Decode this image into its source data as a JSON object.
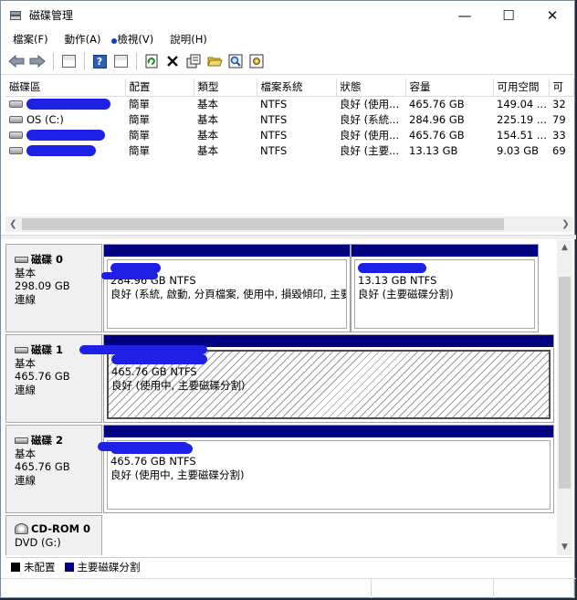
{
  "window": {
    "title": "磁碟管理",
    "buttons": [
      "—",
      "☐",
      "✕"
    ]
  },
  "menu": [
    "檔案(F)",
    "動作(A)",
    "檢視(V)",
    "說明(H)"
  ],
  "toolbar": {
    "icons": [
      "back-arrow-icon",
      "forward-arrow-icon",
      "properties-grid-icon",
      "help-icon",
      "view-grid-icon",
      "refresh-icon",
      "delete-icon",
      "properties-icon",
      "open-folder-icon",
      "explore-icon",
      "settings-icon"
    ]
  },
  "volume_table": {
    "columns": [
      "磁碟區",
      "配置",
      "類型",
      "檔案系統",
      "狀態",
      "容量",
      "可用空間",
      "可"
    ],
    "rows": [
      {
        "name": "",
        "layout": "簡單",
        "type": "基本",
        "fs": "NTFS",
        "status": "良好 (使用...",
        "capacity": "465.76 GB",
        "free": "149.04 ...",
        "pct": "32"
      },
      {
        "name": "OS (C:)",
        "layout": "簡單",
        "type": "基本",
        "fs": "NTFS",
        "status": "良好 (系統...",
        "capacity": "284.96 GB",
        "free": "225.19 ...",
        "pct": "79"
      },
      {
        "name": "",
        "layout": "簡單",
        "type": "基本",
        "fs": "NTFS",
        "status": "良好 (使用...",
        "capacity": "465.76 GB",
        "free": "154.51 ...",
        "pct": "33"
      },
      {
        "name": "",
        "layout": "簡單",
        "type": "基本",
        "fs": "NTFS",
        "status": "良好 (主要...",
        "capacity": "13.13 GB",
        "free": "9.03 GB",
        "pct": "69"
      }
    ]
  },
  "disks": [
    {
      "name": "磁碟 0",
      "kind": "基本",
      "size": "298.09 GB",
      "state": "連線",
      "partitions": [
        {
          "size": "284.96 GB NTFS",
          "status": "良好 (系統, 啟動, 分頁檔案, 使用中, 損毀傾印, 主要磁碟分割)"
        },
        {
          "size": "13.13 GB NTFS",
          "status": "良好 (主要磁碟分割)"
        }
      ]
    },
    {
      "name": "磁碟 1",
      "kind": "基本",
      "size": "465.76 GB",
      "state": "連線",
      "partitions": [
        {
          "size": "465.76 GB NTFS",
          "status": "良好 (使用中, 主要磁碟分割)"
        }
      ]
    },
    {
      "name": "磁碟 2",
      "kind": "基本",
      "size": "465.76 GB",
      "state": "連線",
      "partitions": [
        {
          "size": "465.76 GB NTFS",
          "status": "良好 (使用中, 主要磁碟分割)"
        }
      ]
    },
    {
      "name": "CD-ROM 0",
      "kind": "DVD (G:)",
      "size": "",
      "state": "",
      "partitions": []
    }
  ],
  "legend": [
    {
      "label": "未配置",
      "color": "#000000"
    },
    {
      "label": "主要磁碟分割",
      "color": "#000080"
    }
  ],
  "colors": {
    "primary_partition": "#000080",
    "redaction": "#1e20e6"
  }
}
